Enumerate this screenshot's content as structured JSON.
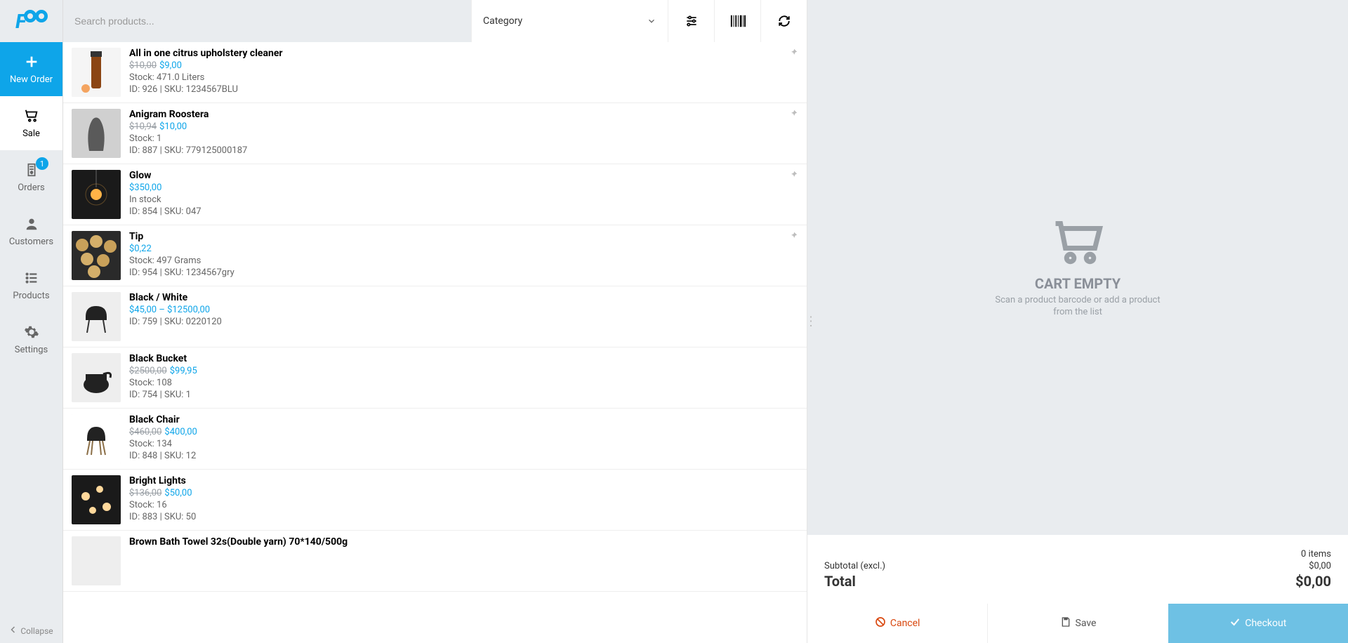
{
  "logo_text": "FOO",
  "sidebar": {
    "new_order": "New Order",
    "sale": "Sale",
    "orders": "Orders",
    "orders_badge": "1",
    "customers": "Customers",
    "products": "Products",
    "settings": "Settings",
    "collapse": "Collapse"
  },
  "searchbar": {
    "placeholder": "Search products...",
    "category_label": "Category"
  },
  "products": [
    {
      "title": "All in one citrus upholstery cleaner",
      "old_price": "$10,00",
      "price": "$9,00",
      "stock": "Stock: 471.0 Liters",
      "idsku": "ID: 926 | SKU: 1234567BLU",
      "pinned": true
    },
    {
      "title": "Anigram Roostera",
      "old_price": "$10,94",
      "price": "$10,00",
      "stock": "Stock: 1",
      "idsku": "ID: 887 | SKU: 779125000187",
      "pinned": true
    },
    {
      "title": "Glow",
      "old_price": "",
      "price": "$350,00",
      "stock": "In stock",
      "idsku": "ID: 854 | SKU: 047",
      "pinned": true
    },
    {
      "title": "Tip",
      "old_price": "",
      "price": "$0,22",
      "stock": "Stock: 497 Grams",
      "idsku": "ID: 954 | SKU: 1234567gry",
      "pinned": true
    },
    {
      "title": "Black / White",
      "old_price": "",
      "price": "$45,00 – $12500,00",
      "stock": "",
      "idsku": "ID: 759 | SKU: 0220120",
      "pinned": false
    },
    {
      "title": "Black Bucket",
      "old_price": "$2500,00",
      "price": "$99,95",
      "stock": "Stock: 108",
      "idsku": "ID: 754 | SKU: 1",
      "pinned": false
    },
    {
      "title": "Black Chair",
      "old_price": "$460,00",
      "price": "$400,00",
      "stock": "Stock: 134",
      "idsku": "ID: 848 | SKU: 12",
      "pinned": false
    },
    {
      "title": "Bright Lights",
      "old_price": "$136,00",
      "price": "$50,00",
      "stock": "Stock: 16",
      "idsku": "ID: 883 | SKU: 50",
      "pinned": false
    },
    {
      "title": "Brown Bath Towel 32s(Double yarn) 70*140/500g",
      "old_price": "",
      "price": "",
      "stock": "",
      "idsku": "",
      "pinned": false
    }
  ],
  "cart": {
    "empty_title": "CART EMPTY",
    "empty_sub": "Scan a product barcode or add a product from the list",
    "items": "0 items",
    "subtotal_label": "Subtotal (excl.)",
    "subtotal_value": "$0,00",
    "total_label": "Total",
    "total_value": "$0,00"
  },
  "actions": {
    "cancel": "Cancel",
    "save": "Save",
    "checkout": "Checkout"
  },
  "icons": {
    "plus": "plus-icon",
    "cart": "cart-icon",
    "orders": "orders-icon",
    "user": "user-icon",
    "list": "list-icon",
    "gear": "gear-icon",
    "chevron_left": "chevron-left-icon",
    "chevron_down": "chevron-down-icon",
    "sliders": "sliders-icon",
    "barcode": "barcode-icon",
    "refresh": "refresh-icon",
    "pin": "pin-icon",
    "ban": "ban-icon",
    "save": "save-icon",
    "check": "check-icon"
  }
}
